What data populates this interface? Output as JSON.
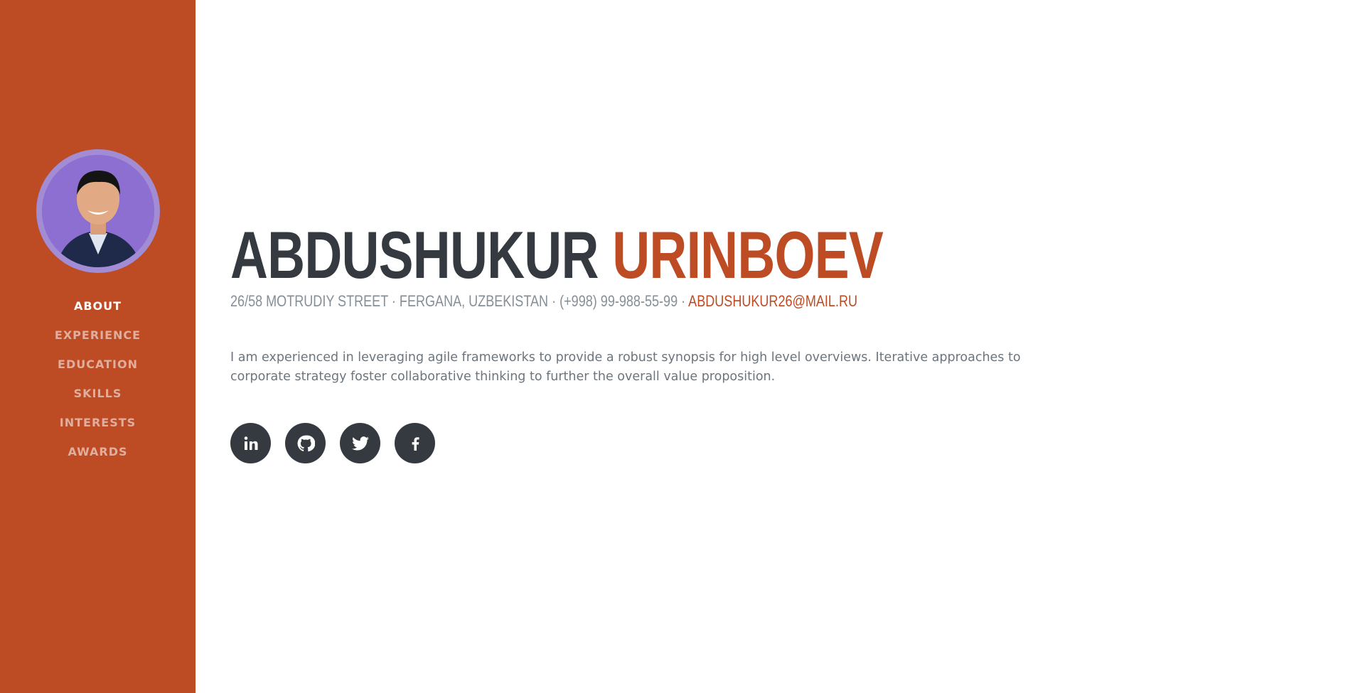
{
  "profile": {
    "first_name": "ABDUSHUKUR",
    "last_name": "URINBOEV",
    "address": "26/58 MOTRUDIY STREET · FERGANA, UZBEKISTAN ·",
    "phone": "(+998) 99-988-55-99 ·",
    "email": "ABDUSHUKUR26@MAIL.RU",
    "about": "I am experienced in leveraging agile frameworks to provide a robust synopsis for high level overviews. Iterative approaches to corporate strategy foster collaborative thinking to further the overall value proposition."
  },
  "nav": {
    "items": [
      {
        "label": "About",
        "active": true
      },
      {
        "label": "Experience"
      },
      {
        "label": "Education"
      },
      {
        "label": "Skills"
      },
      {
        "label": "Interests"
      },
      {
        "label": "Awards"
      }
    ]
  },
  "social": [
    {
      "icon": "linkedin-icon"
    },
    {
      "icon": "github-icon"
    },
    {
      "icon": "twitter-icon"
    },
    {
      "icon": "facebook-icon"
    }
  ],
  "colors": {
    "primary": "#bd4b24",
    "dark": "#343a40",
    "muted": "#868e96",
    "text": "#6c757d"
  }
}
